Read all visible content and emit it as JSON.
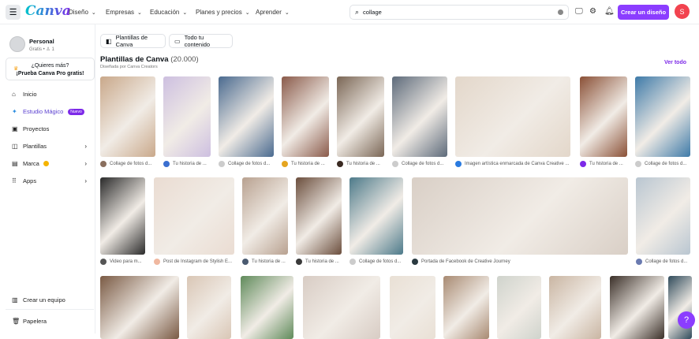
{
  "header": {
    "logo": "Canva",
    "nav": [
      "Diseño",
      "Empresas",
      "Educación",
      "Planes y precios",
      "Aprender"
    ],
    "search_value": "collage",
    "create_label": "Crear un diseño",
    "avatar_initial": "S",
    "accent": "#8b3dff"
  },
  "sidebar": {
    "profile_name": "Personal",
    "profile_sub": "Gratis • ♙ 1",
    "promo_line1": "¿Quieres más?",
    "promo_line2": "¡Prueba Canva Pro gratis!",
    "items": [
      {
        "label": "Inicio",
        "icon": "⌂"
      },
      {
        "label": "Estudio Mágico",
        "icon": "✦",
        "badge": "Nuevo"
      },
      {
        "label": "Proyectos",
        "icon": "▣"
      },
      {
        "label": "Plantillas",
        "icon": "◫",
        "arrow": true
      },
      {
        "label": "Marca",
        "icon": "▤",
        "arrow": true
      },
      {
        "label": "Apps",
        "icon": "⠿",
        "arrow": true
      }
    ],
    "bottom": [
      {
        "label": "Crear un equipo",
        "icon": "▥"
      },
      {
        "label": "Papelera",
        "icon": "🗑"
      }
    ]
  },
  "filters": [
    {
      "label": "Plantillas de Canva",
      "icon": "◧"
    },
    {
      "label": "Todo tu contenido",
      "icon": "▭"
    }
  ],
  "section": {
    "title": "Plantillas de Canva",
    "count": "(20.000)",
    "subtitle": "Diseñada por Canva Creators",
    "see_all": "Ver todo"
  },
  "rows": [
    {
      "captions": [
        "Collage de fotos d...",
        "Tu historia de ...",
        "Collage de fotos d...",
        "Tu historia de ...",
        "Tu historia de ...",
        "Collage de fotos d...",
        "Imagen artística enmarcada de Canva Creative ...",
        "Tu historia de ...",
        "Collage de fotos d..."
      ],
      "colors": [
        "#c9a88a",
        "#cdbfe0",
        "#4a6a8f",
        "#8a5a4a",
        "#7a6655",
        "#5d6a7a",
        "#e3d7ca",
        "#8a5036",
        "#3e7aa8"
      ]
    },
    {
      "captions": [
        "Video para m...",
        "Post de Instagram de Stylish E...",
        "Tu historia de ...",
        "Tu historia de ...",
        "Collage de fotos d...",
        "Portada de Facebook de Creative Journey",
        "Collage de fotos d..."
      ],
      "colors": [
        "#2a2a2a",
        "#eadcd2",
        "#b8a190",
        "#6b4e3d",
        "#4d7a8a",
        "#d9cfc6",
        "#b9c6d1"
      ]
    },
    {
      "colors": [
        "#7a5a44",
        "#d9c6b5",
        "#5f8a5a",
        "#d8ccc4",
        "#e9e0d5",
        "#a88a72",
        "#cfd3cc",
        "#c9b5a2",
        "#3a2f28",
        "#2f4a5a"
      ]
    }
  ]
}
